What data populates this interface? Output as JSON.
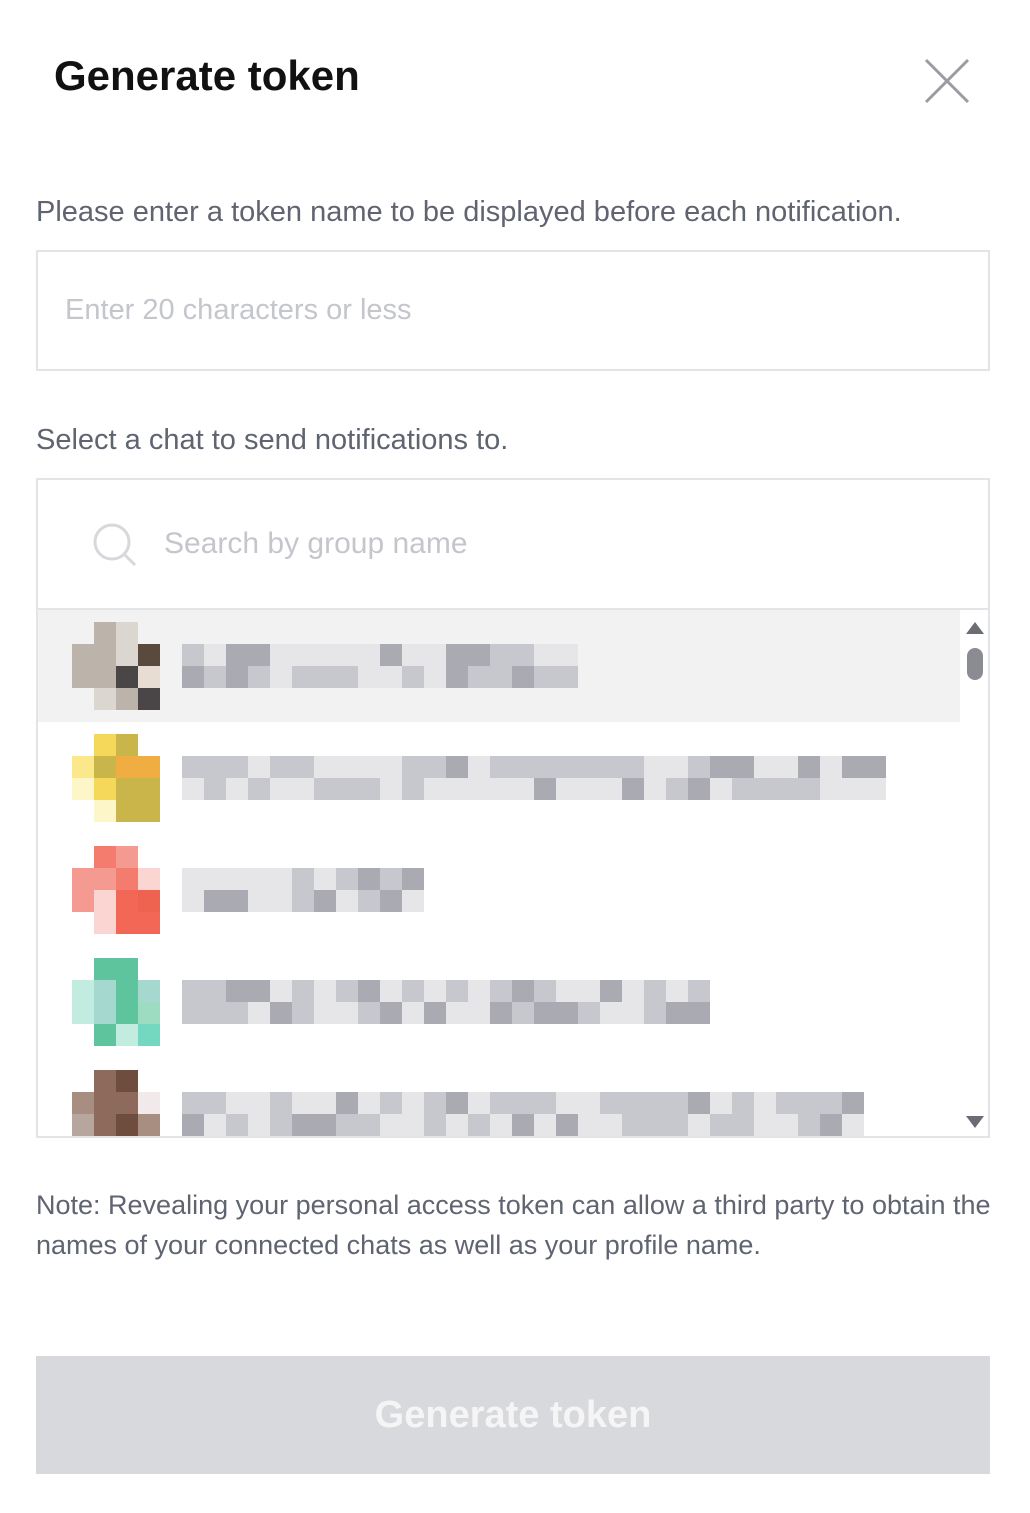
{
  "dialog": {
    "title": "Generate token",
    "close_icon": "close-icon"
  },
  "token_name": {
    "label": "Please enter a token name to be displayed before each notification.",
    "placeholder": "Enter 20 characters or less",
    "value": ""
  },
  "chat_select": {
    "label": "Select a chat to send notifications to.",
    "search_placeholder": "Search by group name",
    "search_icon": "search-icon",
    "items": [
      {
        "selected": true,
        "avatar_colors": [
          "#dcd6d0",
          "#4a4547",
          "#bcb3ab",
          "#e7ddd2",
          "#5a4a3e"
        ]
      },
      {
        "selected": false,
        "avatar_colors": [
          "#fbe88a",
          "#f5d85a",
          "#c9b54a",
          "#f0ad42",
          "#fdf6c8"
        ]
      },
      {
        "selected": false,
        "avatar_colors": [
          "#f37c6e",
          "#f26756",
          "#f49a90",
          "#fad5d1",
          "#ee6350"
        ]
      },
      {
        "selected": false,
        "avatar_colors": [
          "#9edcc2",
          "#74d7c0",
          "#5ec49e",
          "#c2ecdf",
          "#a5d8cf"
        ]
      },
      {
        "selected": false,
        "avatar_colors": [
          "#8d6a5c",
          "#a88e80",
          "#6e4d3f",
          "#f1e9ea",
          "#b6a69e"
        ]
      }
    ],
    "colors": {
      "selected_row": "#f2f2f3",
      "blur_dark": "#a9aab2",
      "blur_mid": "#c7c8cd",
      "blur_light": "#e6e6e9"
    }
  },
  "note": "Note: Revealing your personal access token can allow a third party to obtain the names of your connected chats as well as your profile name.",
  "generate_button": {
    "label": "Generate token",
    "enabled": false,
    "bg_color": "#d8d9dc"
  }
}
